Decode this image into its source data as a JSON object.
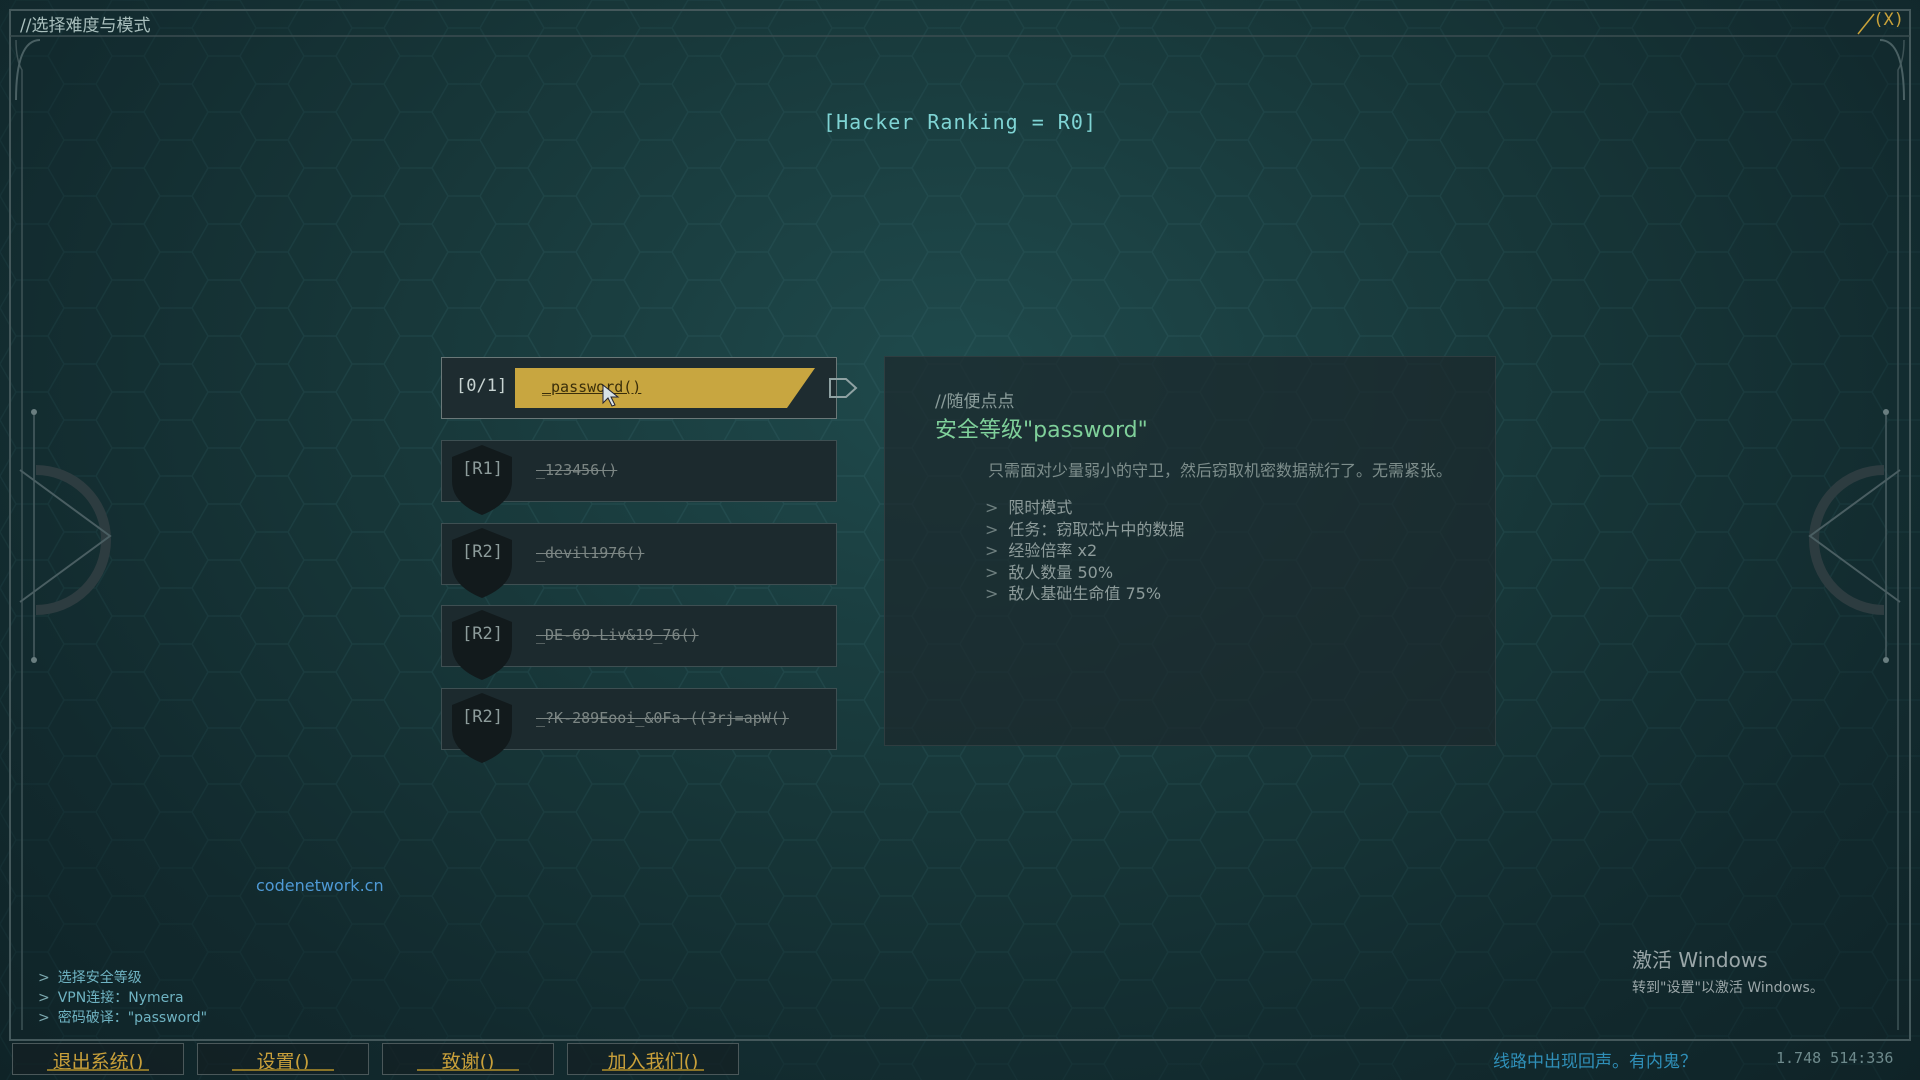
{
  "window": {
    "title": "//选择难度与模式",
    "close_label": "(X)"
  },
  "ranking": "[Hacker Ranking = R0]",
  "levels": [
    {
      "tag": "[0/1]",
      "name": "_password()",
      "selected": true
    },
    {
      "tag": "[R1]",
      "name": "_123456()",
      "selected": false
    },
    {
      "tag": "[R2]",
      "name": "_devil1976()",
      "selected": false
    },
    {
      "tag": "[R2]",
      "name": "_DE-69-Liv&19_76()",
      "selected": false
    },
    {
      "tag": "[R2]",
      "name": "_?K-289Eooi_&0Fa-((3rj=apW()",
      "selected": false
    }
  ],
  "detail": {
    "comment": "//随便点点",
    "title": "安全等级\"password\"",
    "description": "只需面对少量弱小的守卫，然后窃取机密数据就行了。无需紧张。",
    "features": [
      "限时模式",
      "任务：窃取芯片中的数据",
      "经验倍率 x2",
      "敌人数量 50%",
      "敌人基础生命值 75%"
    ]
  },
  "site_link": "codenetwork.cn",
  "status_lines": [
    "选择安全等级",
    "VPN连接：Nymera",
    "密码破译：\"password\""
  ],
  "buttons": [
    {
      "label": "退出系统()"
    },
    {
      "label": "设置()"
    },
    {
      "label": "致谢()"
    },
    {
      "label": "加入我们()"
    }
  ],
  "bottom_message": "线路中出现回声。有内鬼？",
  "bottom_coords": "1.748 514:336",
  "windows_activation": {
    "line1": "激活 Windows",
    "line2": "转到\"设置\"以激活 Windows。"
  },
  "colors": {
    "accent_gold": "#c9a23a",
    "cyan_text": "#7fd4d4",
    "green_title": "#7fd09a",
    "link_blue": "#4f9ad6"
  }
}
